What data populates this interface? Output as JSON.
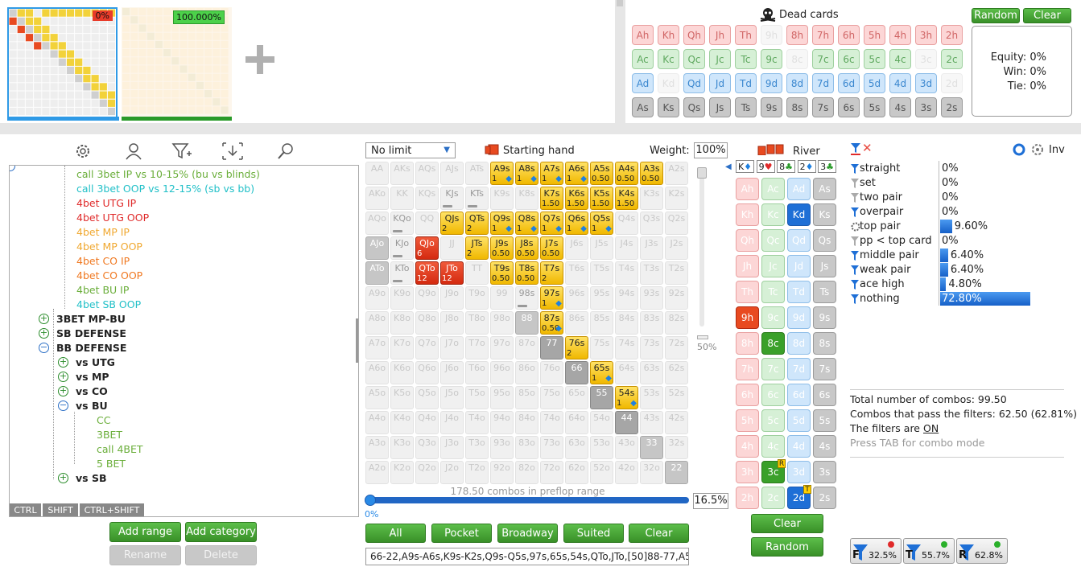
{
  "thumbnails": {
    "first_pct": "0%",
    "second_pct": "100.000%",
    "add_symbol": "+"
  },
  "dead_cards": {
    "title": "Dead cards",
    "random": "Random",
    "clear": "Clear",
    "rows": [
      {
        "suit": "h",
        "cards": [
          "Ah",
          "Kh",
          "Qh",
          "Jh",
          "Th",
          "9h",
          "8h",
          "7h",
          "6h",
          "5h",
          "4h",
          "3h",
          "2h"
        ],
        "dim": [
          5
        ]
      },
      {
        "suit": "c",
        "cards": [
          "Ac",
          "Kc",
          "Qc",
          "Jc",
          "Tc",
          "9c",
          "8c",
          "7c",
          "6c",
          "5c",
          "4c",
          "3c",
          "2c"
        ],
        "dim": [
          6,
          11
        ]
      },
      {
        "suit": "d",
        "cards": [
          "Ad",
          "Kd",
          "Qd",
          "Jd",
          "Td",
          "9d",
          "8d",
          "7d",
          "6d",
          "5d",
          "4d",
          "3d",
          "2d"
        ],
        "dim": [
          1,
          12
        ]
      },
      {
        "suit": "s",
        "cards": [
          "As",
          "Ks",
          "Qs",
          "Js",
          "Ts",
          "9s",
          "8s",
          "7s",
          "6s",
          "5s",
          "4s",
          "3s",
          "2s"
        ],
        "dim": []
      }
    ],
    "equity": "Equity: 0%",
    "win": "Win: 0%",
    "tie": "Tie: 0%"
  },
  "tree": {
    "rows": [
      {
        "text": "call 3bet IP vs 10-15% (bu vs blinds)",
        "color": "#6aae3a"
      },
      {
        "text": "call 3bet OOP vs 12-15% (sb vs bb)",
        "color": "#22c0c8"
      },
      {
        "text": "4bet UTG IP",
        "color": "#e02a2a"
      },
      {
        "text": "4bet UTG OOP",
        "color": "#e02a2a"
      },
      {
        "text": "4bet MP IP",
        "color": "#f0a830"
      },
      {
        "text": "4bet MP OOP",
        "color": "#f0a830"
      },
      {
        "text": "4bet CO IP",
        "color": "#f07820"
      },
      {
        "text": "4bet CO OOP",
        "color": "#f07820"
      },
      {
        "text": "4bet BU IP",
        "color": "#6aae3a"
      },
      {
        "text": "4bet SB OOP",
        "color": "#22c0c8"
      }
    ],
    "groups": {
      "g1": "3BET MP-BU",
      "g2": "SB DEFENSE",
      "g3": "BB DEFENSE"
    },
    "subs": {
      "vs_utg": "vs UTG",
      "vs_mp": "vs MP",
      "vs_co": "vs CO",
      "vs_bu": "vs BU",
      "vs_sb": "vs SB"
    },
    "leaves": {
      "cc": "CC",
      "bet3": "3BET",
      "call4": "call 4BET",
      "bet5": "5 BET"
    },
    "keys": {
      "ctrl": "CTRL",
      "shift": "SHIFT",
      "ctrlshift": "CTRL+SHIFT"
    },
    "buttons": {
      "add_range": "Add range",
      "add_category": "Add category",
      "rename": "Rename",
      "delete": "Delete"
    }
  },
  "matrix": {
    "game": "No limit",
    "starting_hand": "Starting hand",
    "weight_label": "Weight:",
    "weight": "100%",
    "combos": "178.50 combos in preflop range",
    "slider_pct": "16.5%",
    "slider_left": "0%",
    "vslider_pct": "50%",
    "buttons": {
      "all": "All",
      "pocket": "Pocket",
      "broadway": "Broadway",
      "suited": "Suited",
      "clear": "Clear"
    },
    "range_text": "66-22,A9s-A6s,K9s-K2s,Q9s-Q5s,97s,65s,54s,QTo,JTo,[50]88-77,A5",
    "ranks": [
      "A",
      "K",
      "Q",
      "J",
      "T",
      "9",
      "8",
      "7",
      "6",
      "5",
      "4",
      "3",
      "2"
    ],
    "special": {
      "A9s": [
        "y",
        "1",
        true
      ],
      "A8s": [
        "y",
        "1",
        true
      ],
      "A7s": [
        "y",
        "1",
        true
      ],
      "A6s": [
        "y",
        "1",
        true
      ],
      "A5s": [
        "y",
        "0.50",
        false
      ],
      "A4s": [
        "y",
        "0.50",
        false
      ],
      "A3s": [
        "y",
        "0.50",
        false
      ],
      "K7s": [
        "y",
        "1.50",
        false
      ],
      "K6s": [
        "y",
        "1.50",
        false
      ],
      "K5s": [
        "y",
        "1.50",
        false
      ],
      "K4s": [
        "y",
        "1.50",
        false
      ],
      "QJs": [
        "y",
        "2",
        false
      ],
      "QTs": [
        "y",
        "2",
        false
      ],
      "Q9s": [
        "y",
        "1",
        true
      ],
      "Q8s": [
        "y",
        "1",
        true
      ],
      "Q7s": [
        "y",
        "1",
        true
      ],
      "Q6s": [
        "y",
        "1",
        true
      ],
      "Q5s": [
        "y",
        "1",
        true
      ],
      "QJo": [
        "r",
        "6",
        false
      ],
      "JTs": [
        "y",
        "2",
        false
      ],
      "J9s": [
        "y",
        "0.50",
        false
      ],
      "J8s": [
        "y",
        "0.50",
        false
      ],
      "J7s": [
        "y",
        "0.50",
        false
      ],
      "QTo": [
        "r",
        "12",
        false
      ],
      "JTo": [
        "r",
        "12",
        false
      ],
      "T9s": [
        "y",
        "0.50",
        false
      ],
      "T8s": [
        "y",
        "0.50",
        false
      ],
      "T7s": [
        "y",
        "2",
        false
      ],
      "97s": [
        "y",
        "1",
        true
      ],
      "87s": [
        "y",
        "0.50",
        true
      ],
      "76s": [
        "y",
        "2",
        false
      ],
      "65s": [
        "y",
        "1",
        true
      ],
      "54s": [
        "y",
        "1",
        true
      ],
      "KJs": [
        "b",
        "",
        false
      ],
      "KTs": [
        "b",
        "",
        false
      ],
      "KQo": [
        "b",
        "",
        false
      ],
      "AJo": [
        "g",
        "",
        false
      ],
      "KJo": [
        "b",
        "",
        false
      ],
      "ATo": [
        "g",
        "",
        false
      ],
      "KTo": [
        "b",
        "",
        false
      ],
      "98s": [
        "b",
        "",
        false
      ],
      "88": [
        "g",
        "",
        false
      ],
      "77": [
        "dg",
        "",
        false
      ],
      "66": [
        "dg",
        "",
        false
      ],
      "55": [
        "dg",
        "",
        false
      ],
      "44": [
        "dg",
        "",
        false
      ],
      "33": [
        "g",
        "",
        false
      ],
      "22": [
        "g",
        "",
        false
      ]
    }
  },
  "board": {
    "river_label": "River",
    "board": [
      "K♦",
      "9♥",
      "8♣",
      "2♦",
      "3♣"
    ],
    "cols": [
      "h",
      "c",
      "d",
      "s"
    ],
    "ranks": [
      "A",
      "K",
      "Q",
      "J",
      "T",
      "9",
      "8",
      "7",
      "6",
      "5",
      "4",
      "3",
      "2"
    ],
    "clear": "Clear",
    "random": "Random"
  },
  "filters": {
    "inv": "Inv",
    "items": [
      {
        "label": "straight",
        "value": "0%",
        "pct": 0
      },
      {
        "label": "set",
        "value": "0%",
        "pct": 0
      },
      {
        "label": "two pair",
        "value": "0%",
        "pct": 0
      },
      {
        "label": "overpair",
        "value": "0%",
        "pct": 0
      },
      {
        "label": "top pair",
        "value": "9.60%",
        "pct": 9.6
      },
      {
        "label": "pp < top card",
        "value": "0%",
        "pct": 0
      },
      {
        "label": "middle pair",
        "value": "6.40%",
        "pct": 6.4
      },
      {
        "label": "weak pair",
        "value": "6.40%",
        "pct": 6.4
      },
      {
        "label": "ace high",
        "value": "4.80%",
        "pct": 4.8
      },
      {
        "label": "nothing",
        "value": "72.80%",
        "pct": 72.8
      }
    ],
    "total": "Total number of combos: 99.50",
    "pass": "Combos that pass the filters: 62.50 (62.81%)",
    "filters_on_prefix": "The filters are ",
    "filters_on": "ON",
    "press_tab": "Press TAB for combo mode",
    "chips": [
      {
        "letter": "F",
        "value": "32.5%"
      },
      {
        "letter": "T",
        "value": "55.7%"
      },
      {
        "letter": "R",
        "value": "62.8%"
      }
    ]
  }
}
